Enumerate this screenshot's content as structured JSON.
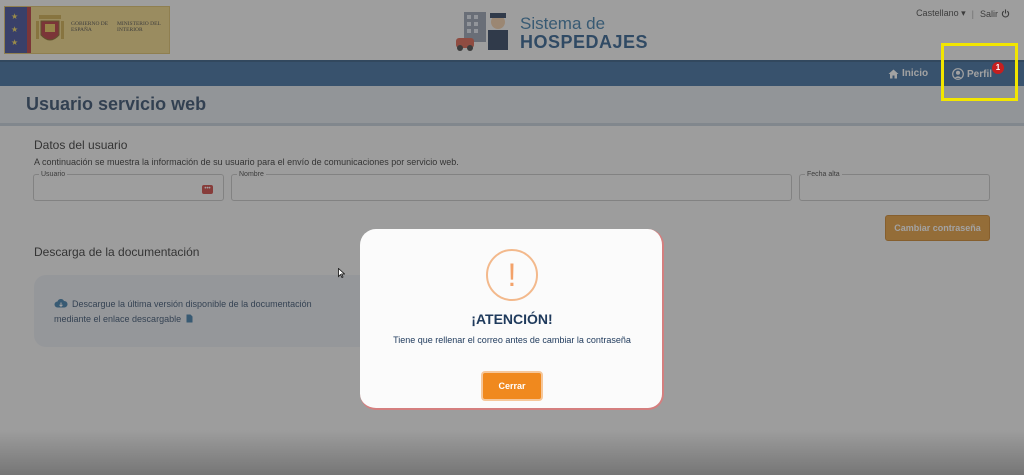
{
  "header": {
    "gov_text": "GOBIERNO DE ESPAÑA",
    "ministry_text": "MINISTERIO DEL INTERIOR",
    "brand_line1": "Sistema de",
    "brand_line2": "HOSPEDAJES",
    "language": "Castellano",
    "language_caret": "▾",
    "separator": "|",
    "logout": "Salir"
  },
  "nav": {
    "home": "Inicio",
    "profile": "Perfil",
    "profile_badge": "1"
  },
  "page": {
    "title": "Usuario servicio web",
    "user_section_title": "Datos del usuario",
    "description": "A continuación se muestra la información de su usuario para el envío de comunicaciones por servicio web.",
    "fields": {
      "usuario_label": "Usuario",
      "usuario_value": "",
      "nombre_label": "Nombre",
      "nombre_value": "",
      "fecha_label": "Fecha alta",
      "fecha_value": ""
    },
    "change_password_button": "Cambiar contraseña",
    "docs_section_title": "Descarga de la documentación",
    "docs_text_line1": "Descargue la última versión disponible de la documentación",
    "docs_text_line2": "mediante el enlace descargable"
  },
  "modal": {
    "icon": "!",
    "title": "¡ATENCIÓN!",
    "message": "Tiene que rellenar el correo antes de cambiar la contraseña",
    "close_button": "Cerrar"
  },
  "colors": {
    "navbar": "#2b5f94",
    "accent_orange": "#f0891e",
    "badge_red": "#c51f1f",
    "highlight_yellow": "#f2e600"
  }
}
